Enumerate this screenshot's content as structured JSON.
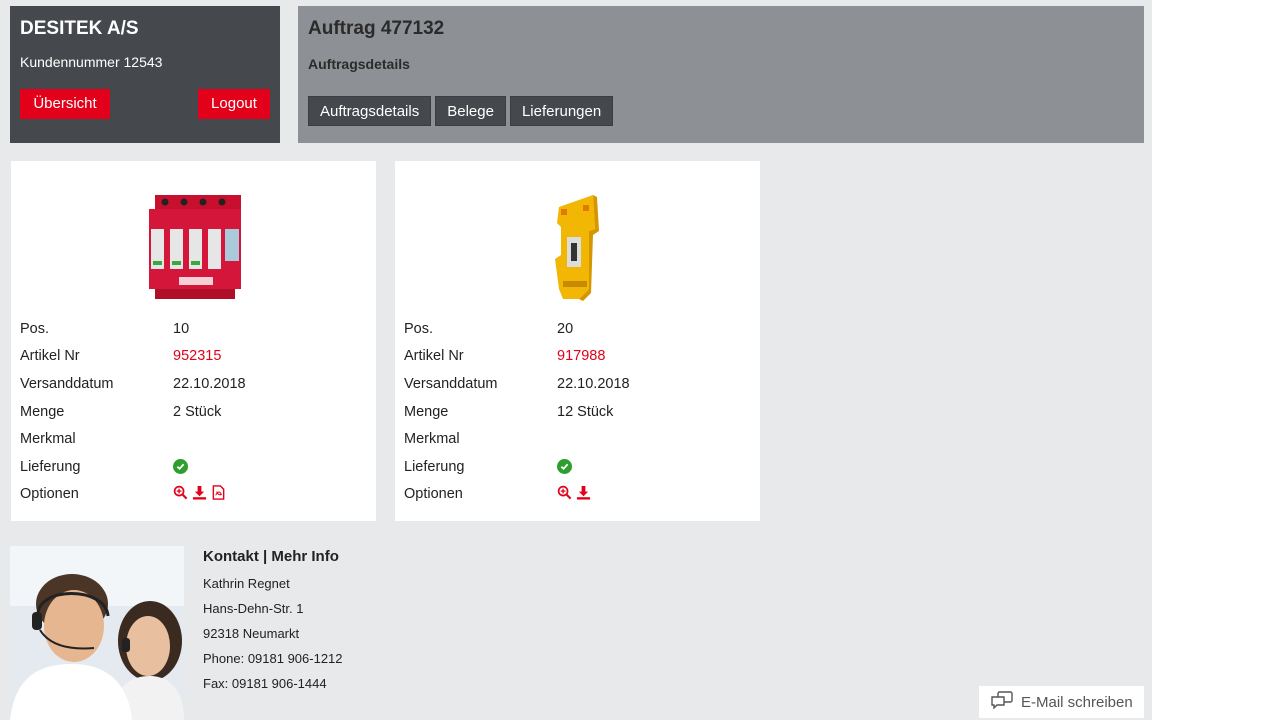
{
  "customer": {
    "company": "DESITEK A/S",
    "customer_number": "Kundennummer 12543",
    "overview_label": "Übersicht",
    "logout_label": "Logout"
  },
  "order": {
    "title": "Auftrag 477132",
    "subtitle": "Auftragsdetails",
    "tabs": [
      {
        "label": "Auftragsdetails"
      },
      {
        "label": "Belege"
      },
      {
        "label": "Lieferungen"
      }
    ]
  },
  "labels": {
    "pos": "Pos.",
    "article": "Artikel Nr",
    "ship_date": "Versanddatum",
    "quantity": "Menge",
    "feature": "Merkmal",
    "delivery": "Lieferung",
    "options": "Optionen"
  },
  "items": [
    {
      "pos": "10",
      "article": "952315",
      "ship_date": "22.10.2018",
      "quantity": "2 Stück",
      "feature": "",
      "delivery_icon": "check-circle-icon",
      "options": [
        "zoom-icon",
        "download-icon",
        "pdf-icon"
      ]
    },
    {
      "pos": "20",
      "article": "917988",
      "ship_date": "22.10.2018",
      "quantity": "12 Stück",
      "feature": "",
      "delivery_icon": "check-circle-icon",
      "options": [
        "zoom-icon",
        "download-icon"
      ]
    }
  ],
  "contact": {
    "title": "Kontakt | Mehr Info",
    "name": "Kathrin Regnet",
    "street": "Hans-Dehn-Str. 1",
    "city": "92318 Neumarkt",
    "phone": "Phone: 09181 906-1212",
    "fax": "Fax: 09181 906-1444"
  },
  "email_button": {
    "label": "E-Mail schreiben",
    "icon": "chat-icon"
  },
  "colors": {
    "accent": "#e2001a",
    "dark": "#45484d",
    "header_grey": "#8d9095",
    "background": "#e8e9eb",
    "success": "#2e9e2e"
  }
}
